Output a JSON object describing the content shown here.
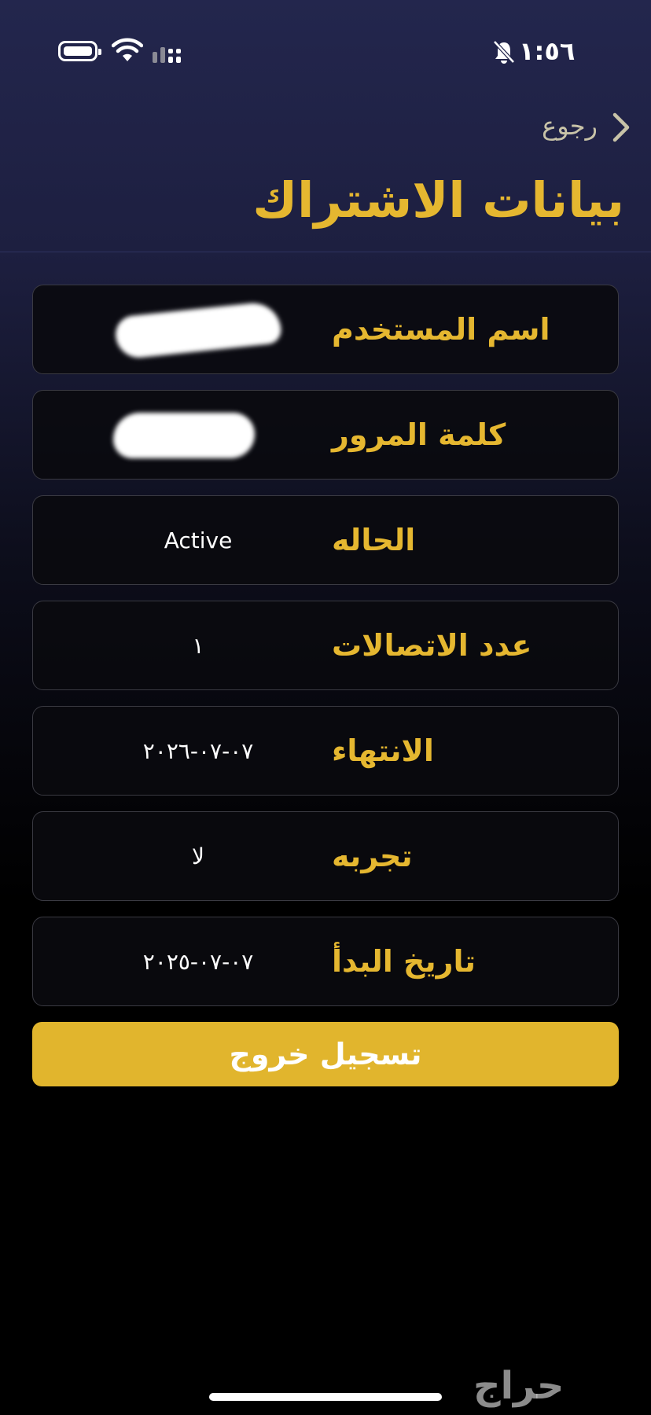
{
  "status_bar": {
    "time": "١:٥٦",
    "icons": [
      "battery-icon",
      "wifi-icon",
      "signal-icon",
      "bell-muted-icon"
    ]
  },
  "header": {
    "back_label": "رجوع",
    "title": "بيانات الاشتراك"
  },
  "rows": [
    {
      "label": "اسم المستخدم",
      "value": "",
      "redacted": true
    },
    {
      "label": "كلمة المرور",
      "value": "",
      "redacted": true
    },
    {
      "label": "الحاله",
      "value": "Active",
      "redacted": false
    },
    {
      "label": "عدد الاتصالات",
      "value": "١",
      "redacted": false
    },
    {
      "label": "الانتهاء",
      "value": "٠٧-٠٧-٢٠٢٦",
      "redacted": false
    },
    {
      "label": "تجربه",
      "value": "لا",
      "redacted": false
    },
    {
      "label": "تاريخ البدأ",
      "value": "٠٧-٠٧-٢٠٢٥",
      "redacted": false
    }
  ],
  "logout_label": "تسجيل خروج",
  "watermark": "حراج",
  "colors": {
    "accent": "#e5b730",
    "button": "#e1b52d",
    "header_bg": "#23264d",
    "row_border": "#3a3a42"
  }
}
